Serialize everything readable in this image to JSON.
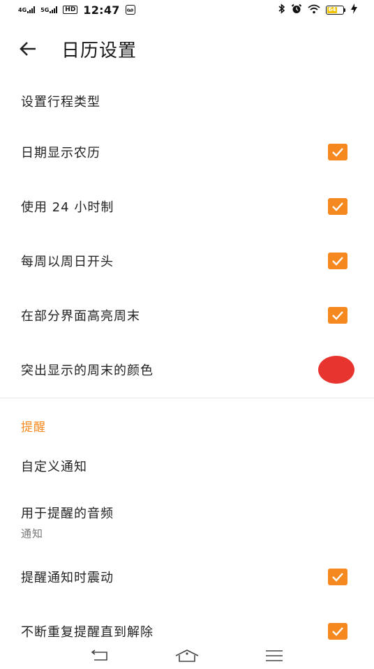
{
  "status_bar": {
    "sim1": "4G",
    "sim2": "5G",
    "hd": "HD",
    "time": "12:47",
    "battery_level": "64",
    "battery_fraction": 0.64
  },
  "app_bar": {
    "title": "日历设置"
  },
  "settings": [
    {
      "label": "设置行程类型",
      "control": "none"
    },
    {
      "label": "日期显示农历",
      "control": "checkbox",
      "checked": true
    },
    {
      "label": "使用 24 小时制",
      "control": "checkbox",
      "checked": true
    },
    {
      "label": "每周以周日开头",
      "control": "checkbox",
      "checked": true
    },
    {
      "label": "在部分界面高亮周末",
      "control": "checkbox",
      "checked": true
    },
    {
      "label": "突出显示的周末的颜色",
      "control": "color",
      "color": "#e8342e"
    }
  ],
  "reminder_section": {
    "header": "提醒",
    "items": [
      {
        "label": "自定义通知",
        "control": "none"
      },
      {
        "label": "用于提醒的音频",
        "sub": "通知",
        "control": "none"
      },
      {
        "label": "提醒通知时震动",
        "control": "checkbox",
        "checked": true
      },
      {
        "label": "不断重复提醒直到解除",
        "control": "checkbox",
        "checked": true
      }
    ]
  },
  "colors": {
    "accent": "#f5891f",
    "section_header": "#f5891f",
    "weekend_highlight": "#e8342e"
  },
  "icons": {
    "back": "arrow-left-icon",
    "nav_back": "nav-back-icon",
    "nav_home": "nav-home-icon",
    "nav_menu": "nav-menu-icon"
  }
}
